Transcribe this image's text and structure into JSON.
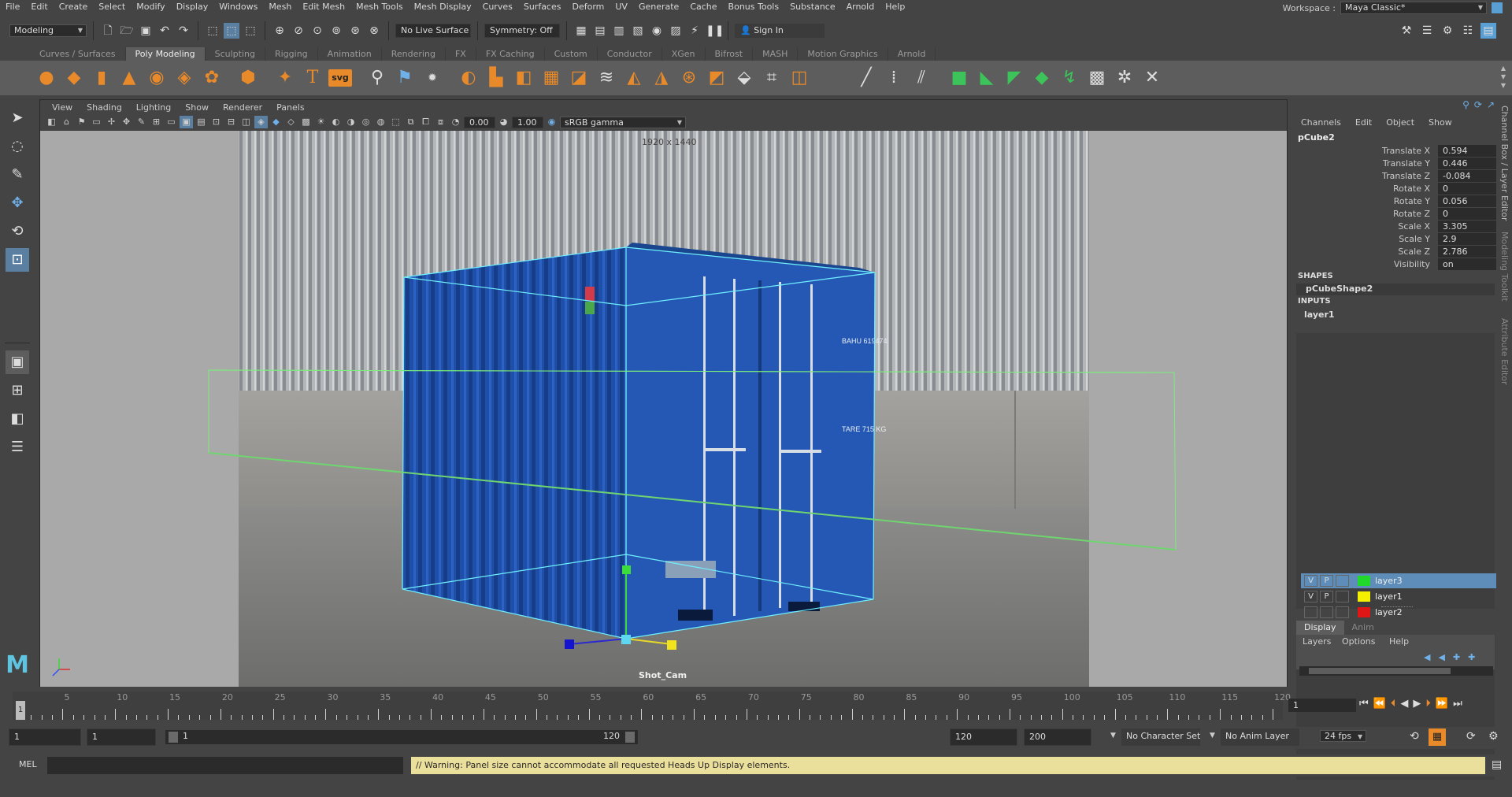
{
  "menubar": {
    "items": [
      "File",
      "Edit",
      "Create",
      "Select",
      "Modify",
      "Display",
      "Windows",
      "Mesh",
      "Edit Mesh",
      "Mesh Tools",
      "Mesh Display",
      "Curves",
      "Surfaces",
      "Deform",
      "UV",
      "Generate",
      "Cache",
      "Bonus Tools",
      "Substance",
      "Arnold",
      "Help"
    ],
    "workspace_label": "Workspace :",
    "workspace_value": "Maya Classic*"
  },
  "statusline": {
    "mode": "Modeling",
    "live_surface": "No Live Surface",
    "symmetry": "Symmetry: Off",
    "sign_in": "Sign In"
  },
  "shelf": {
    "tabs": [
      "Curves / Surfaces",
      "Poly Modeling",
      "Sculpting",
      "Rigging",
      "Animation",
      "Rendering",
      "FX",
      "FX Caching",
      "Custom",
      "Conductor",
      "XGen",
      "Bifrost",
      "MASH",
      "Motion Graphics",
      "Arnold"
    ],
    "active_tab": "Poly Modeling",
    "svg_label": "svg"
  },
  "viewport": {
    "menu": [
      "View",
      "Shading",
      "Lighting",
      "Show",
      "Renderer",
      "Panels"
    ],
    "exposure": "0.00",
    "gamma": "1.00",
    "colorspace": "sRGB gamma",
    "resolution": "1920 x 1440",
    "camera": "Shot_Cam",
    "container_id": "BAHU 619474",
    "container_tare": "TARE 715 KG"
  },
  "channelbox": {
    "menu": [
      "Channels",
      "Edit",
      "Object",
      "Show"
    ],
    "object": "pCube2",
    "channels": [
      {
        "label": "Translate X",
        "value": "0.594"
      },
      {
        "label": "Translate Y",
        "value": "0.446"
      },
      {
        "label": "Translate Z",
        "value": "-0.084"
      },
      {
        "label": "Rotate X",
        "value": "0"
      },
      {
        "label": "Rotate Y",
        "value": "0.056"
      },
      {
        "label": "Rotate Z",
        "value": "0"
      },
      {
        "label": "Scale X",
        "value": "3.305"
      },
      {
        "label": "Scale Y",
        "value": "2.9"
      },
      {
        "label": "Scale Z",
        "value": "2.786"
      },
      {
        "label": "Visibility",
        "value": "on"
      }
    ],
    "shapes_header": "SHAPES",
    "shape": "pCubeShape2",
    "inputs_header": "INPUTS",
    "input": "layer1"
  },
  "layereditor": {
    "tabs": [
      "Display",
      "Anim"
    ],
    "menu": [
      "Layers",
      "Options",
      "Help"
    ],
    "layers": [
      {
        "v": "V",
        "p": "P",
        "color": "#21d92b",
        "name": "layer3"
      },
      {
        "v": "V",
        "p": "P",
        "color": "#f5f000",
        "name": "layer1"
      },
      {
        "v": "",
        "p": "",
        "color": "#e01515",
        "name": "layer2"
      }
    ]
  },
  "sidetabs": [
    "Channel Box / Layer Editor",
    "Modeling Toolkit",
    "Attribute Editor"
  ],
  "timeline": {
    "labels": [
      "5",
      "10",
      "15",
      "20",
      "25",
      "30",
      "35",
      "40",
      "45",
      "50",
      "55",
      "60",
      "65",
      "70",
      "75",
      "80",
      "85",
      "90",
      "95",
      "100",
      "105",
      "110",
      "115",
      "120"
    ],
    "current_frame_marker": "1",
    "current_frame": "1"
  },
  "range": {
    "start": "1",
    "playback_start": "1",
    "slider_start": "1",
    "slider_end": "120",
    "playback_end": "120",
    "end": "200",
    "character_set": "No Character Set",
    "anim_layer": "No Anim Layer",
    "fps": "24 fps"
  },
  "cmdline": {
    "lang": "MEL",
    "message": "// Warning: Panel size cannot accommodate all requested Heads Up Display elements."
  }
}
